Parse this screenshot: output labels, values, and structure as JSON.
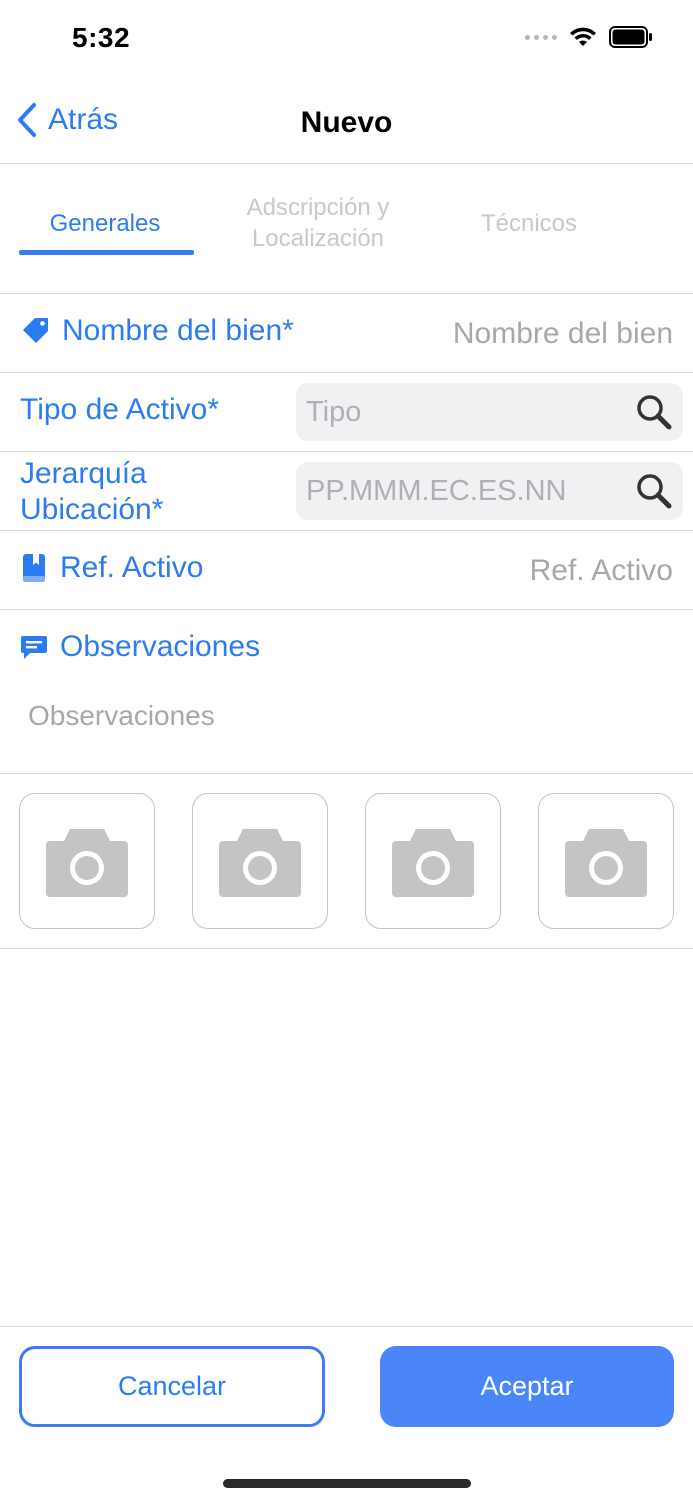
{
  "status_bar": {
    "time": "5:32"
  },
  "nav": {
    "back_label": "Atrás",
    "title": "Nuevo"
  },
  "tabs": [
    {
      "label": "Generales",
      "active": true
    },
    {
      "label": "Adscripción y\nLocalización",
      "active": false
    },
    {
      "label": "Técnicos",
      "active": false
    }
  ],
  "form": {
    "nombre": {
      "label": "Nombre del bien*",
      "placeholder": "Nombre del bien",
      "icon": "tag-icon"
    },
    "tipo": {
      "label": "Tipo de Activo*",
      "placeholder": "Tipo",
      "icon": "search-icon"
    },
    "jerarquia": {
      "label_line1": "Jerarquía",
      "label_line2": "Ubicación*",
      "placeholder": "PP.MMM.EC.ES.NN",
      "icon": "search-icon"
    },
    "ref": {
      "label": "Ref. Activo",
      "placeholder": "Ref. Activo",
      "icon": "book-icon"
    },
    "observaciones": {
      "label": "Observaciones",
      "placeholder": "Observaciones",
      "icon": "chat-bubble-icon"
    }
  },
  "photos": {
    "count": 4,
    "icon": "camera-icon"
  },
  "footer": {
    "cancel_label": "Cancelar",
    "accept_label": "Aceptar"
  },
  "colors": {
    "accent": "#2b7cf0",
    "button_fill": "#4a86f7",
    "placeholder": "#a8a8a8",
    "divider": "#dcdcdc",
    "search_field_bg": "#f1f1f3",
    "camera_gray": "#c4c4c4"
  }
}
